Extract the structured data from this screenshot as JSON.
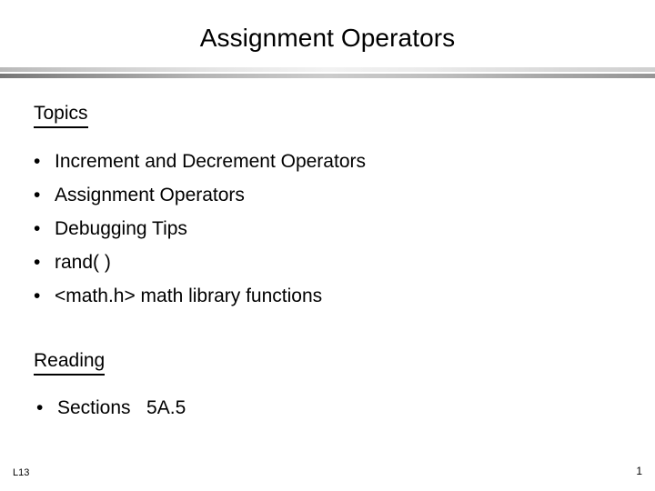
{
  "slide": {
    "title": "Assignment Operators",
    "sections": [
      {
        "heading": "Topics",
        "bullet_glyph": "•",
        "items": [
          "Increment and Decrement Operators",
          "Assignment Operators",
          "Debugging Tips",
          "rand( )",
          "<math.h> math library functions"
        ]
      },
      {
        "heading": "Reading",
        "bullet_glyph": "•",
        "items": [
          "Sections   5A.5"
        ]
      }
    ],
    "footer": {
      "label": "L13",
      "page_number": "1"
    },
    "colors": {
      "background": "#ffffff",
      "text": "#000000",
      "divider_top": "#c9c9c9",
      "divider_bottom": "#8c8c8c"
    }
  }
}
